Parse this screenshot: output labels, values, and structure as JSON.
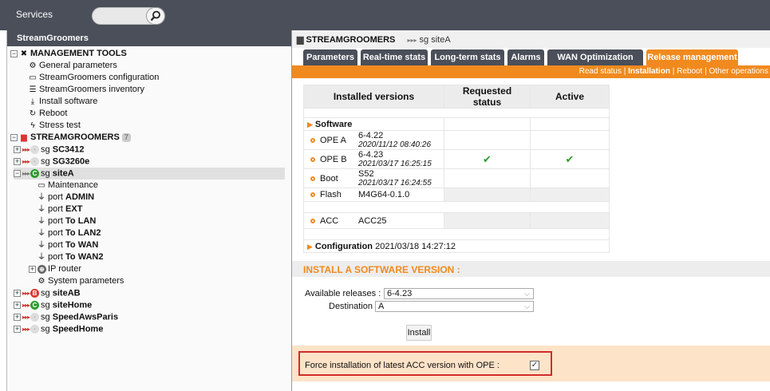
{
  "topbar": {
    "services_label": "Services",
    "search_placeholder": ""
  },
  "left": {
    "header": "StreamGroomers",
    "tree": [
      {
        "label": "MANAGEMENT TOOLS",
        "bold": true
      },
      {
        "label": "General parameters"
      },
      {
        "label": "StreamGroomers configuration"
      },
      {
        "label": "StreamGroomers inventory"
      },
      {
        "label": "Install software"
      },
      {
        "label": "Reboot"
      },
      {
        "label": "Stress test"
      },
      {
        "label": "STREAMGROOMERS",
        "count": "7"
      },
      {
        "prefix": "sg",
        "label": "SC3412"
      },
      {
        "prefix": "sg",
        "label": "SG3260e"
      },
      {
        "prefix": "sg",
        "label": "siteA"
      },
      {
        "label": "Maintenance"
      },
      {
        "prefix": "port",
        "label": "ADMIN"
      },
      {
        "prefix": "port",
        "label": "EXT"
      },
      {
        "prefix": "port",
        "label": "To LAN"
      },
      {
        "prefix": "port",
        "label": "To LAN2"
      },
      {
        "prefix": "port",
        "label": "To WAN"
      },
      {
        "prefix": "port",
        "label": "To WAN2"
      },
      {
        "label": "IP router"
      },
      {
        "label": "System parameters"
      },
      {
        "prefix": "sg",
        "label": "siteAB"
      },
      {
        "prefix": "sg",
        "label": "siteHome"
      },
      {
        "prefix": "sg",
        "label": "SpeedAwsParis"
      },
      {
        "prefix": "sg",
        "label": "SpeedHome"
      }
    ]
  },
  "right": {
    "title": "STREAMGROOMERS",
    "breadcrumb": "sg siteA",
    "tabs": [
      "Parameters",
      "Real-time stats",
      "Long-term stats",
      "Alarms",
      "WAN Optimization",
      "Release management"
    ],
    "subnav": {
      "read": "Read status",
      "installation": "Installation",
      "reboot": "Reboot",
      "other": "Other operations",
      "sep": " | "
    },
    "versions": {
      "headers": [
        "Installed versions",
        "Requested status",
        "Active"
      ],
      "software_label": "Software",
      "rows": [
        {
          "name": "OPE A",
          "version": "6-4.22",
          "date": "2020/11/12 08:40:26",
          "requested": "",
          "active": ""
        },
        {
          "name": "OPE B",
          "version": "6-4.23",
          "date": "2021/03/17 16:25:15",
          "requested": "✔",
          "active": "✔"
        },
        {
          "name": "Boot",
          "version": "S52",
          "date": "2021/03/17 16:24:55",
          "requested": "",
          "active": ""
        },
        {
          "name": "Flash",
          "version": "M4G64-0.1.0",
          "date": "",
          "requested": "",
          "active": ""
        },
        {
          "name": "ACC",
          "version": "ACC25",
          "date": "",
          "requested": "",
          "active": ""
        }
      ],
      "configuration_label": "Configuration",
      "configuration_date": "2021/03/18 14:27:12"
    },
    "install": {
      "title": "INSTALL A SOFTWARE VERSION :",
      "releases_label": "Available releases :",
      "releases_value": "6-4.23",
      "destination_label": "Destination :",
      "destination_value": "A",
      "install_button": "Install",
      "force_label": "Force installation of latest ACC version with OPE :",
      "force_checked": "✓"
    }
  }
}
